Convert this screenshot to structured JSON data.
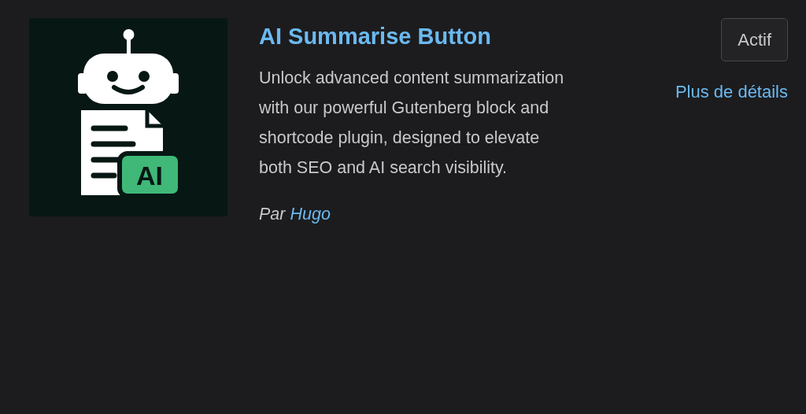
{
  "plugin": {
    "title": "AI Summarise Button",
    "description": "Unlock advanced content summarization with our powerful Gutenberg block and shortcode plugin, designed to elevate both SEO and AI search visibility.",
    "byline_prefix": "Par",
    "author": "Hugo",
    "icon_badge": "AI"
  },
  "status_button": {
    "label": "Actif"
  },
  "details_link": "Plus de détails"
}
